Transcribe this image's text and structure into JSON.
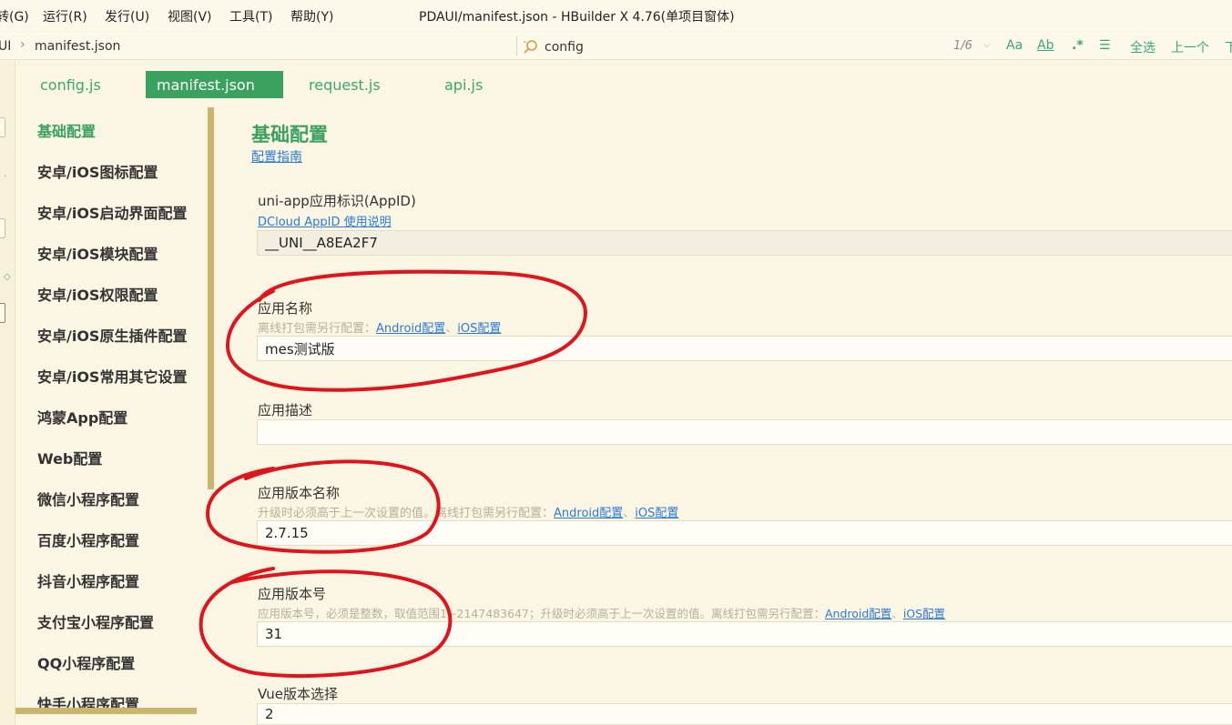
{
  "menu": {
    "items": [
      "转(G)",
      "运行(R)",
      "发行(U)",
      "视图(V)",
      "工具(T)",
      "帮助(Y)"
    ],
    "window_title": "PDAUI/manifest.json - HBuilder X 4.76(单项目窗体)"
  },
  "pathbar": {
    "crumb_parent": "UI",
    "crumb_file": "manifest.json",
    "search_value": "config",
    "match_count": "1/6",
    "tools": [
      "Aa",
      "A̲b̲",
      ".*",
      "☰",
      "全选",
      "上一个",
      "下"
    ]
  },
  "tabs": [
    {
      "label": "config.js",
      "active": false
    },
    {
      "label": "manifest.json",
      "active": true
    },
    {
      "label": "request.js",
      "active": false
    },
    {
      "label": "api.js",
      "active": false
    }
  ],
  "sidebar": {
    "items": [
      "基础配置",
      "安卓/iOS图标配置",
      "安卓/iOS启动界面配置",
      "安卓/iOS模块配置",
      "安卓/iOS权限配置",
      "安卓/iOS原生插件配置",
      "安卓/iOS常用其它设置",
      "鸿蒙App配置",
      "Web配置",
      "微信小程序配置",
      "百度小程序配置",
      "抖音小程序配置",
      "支付宝小程序配置",
      "QQ小程序配置",
      "快手小程序配置"
    ],
    "active_index": 0
  },
  "main": {
    "title": "基础配置",
    "guide_link": "配置指南",
    "appid": {
      "label": "uni-app应用标识(AppID)",
      "help_link": "DCloud AppID 使用说明",
      "value": "__UNI__A8EA2F7"
    },
    "app_name": {
      "label": "应用名称",
      "hint": "离线打包需另行配置：",
      "link_android": "Android配置",
      "sep": "、",
      "link_ios": "iOS配置",
      "value": "mes测试版"
    },
    "app_desc": {
      "label": "应用描述",
      "value": ""
    },
    "version_name": {
      "label": "应用版本名称",
      "hint": "升级时必须高于上一次设置的值。离线打包需另行配置：",
      "link_android": "Android配置",
      "sep": "、",
      "link_ios": "iOS配置",
      "value": "2.7.15"
    },
    "version_code": {
      "label": "应用版本号",
      "hint": "应用版本号，必须是整数，取值范围1~2147483647；升级时必须高于上一次设置的值。离线打包需另行配置：",
      "link_android": "Android配置",
      "sep": "、",
      "link_ios": "iOS配置",
      "value": "31"
    },
    "vue_version": {
      "label": "Vue版本选择",
      "value": "2"
    }
  },
  "colors": {
    "accent": "#3aa15e",
    "link": "#2a7ad6",
    "annotation": "#e0141c",
    "background": "#fbf6e3"
  }
}
